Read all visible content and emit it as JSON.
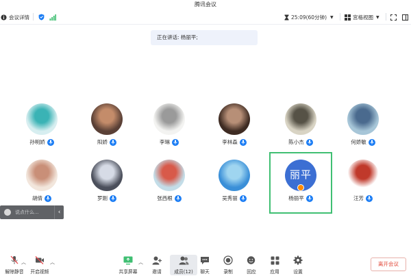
{
  "window": {
    "title": "腾讯会议"
  },
  "topbar": {
    "meeting_info": "会议详情",
    "timer": "25:09(60分钟)",
    "view_mode": "宫格视图"
  },
  "speaking": {
    "text": "正在讲话: 杨丽平;"
  },
  "participants": [
    {
      "name": "孙明娇",
      "avatar_colors": [
        "#d7eef0",
        "#3ab3b5"
      ]
    },
    {
      "name": "阳娇",
      "avatar_colors": [
        "#5a4036",
        "#c48c6a"
      ]
    },
    {
      "name": "李琳",
      "avatar_colors": [
        "#f3f3f1",
        "#9a9a9a"
      ]
    },
    {
      "name": "李林森",
      "avatar_colors": [
        "#3e2b22",
        "#b78f77"
      ]
    },
    {
      "name": "陈小杰",
      "avatar_colors": [
        "#d9d4c4",
        "#565246"
      ]
    },
    {
      "name": "何娇敏",
      "avatar_colors": [
        "#a7c6d8",
        "#4a6a8e"
      ]
    },
    {
      "name": "胡倩",
      "avatar_colors": [
        "#f2e6dc",
        "#c98f78"
      ]
    },
    {
      "name": "罗刚",
      "avatar_colors": [
        "#4b4f5b",
        "#d6dbe6"
      ]
    },
    {
      "name": "张西根",
      "avatar_colors": [
        "#c3dde8",
        "#d85a4a"
      ]
    },
    {
      "name": "吴秀丽",
      "avatar_colors": [
        "#3a8fd8",
        "#9fd5f0"
      ]
    },
    {
      "name": "杨丽平",
      "avatar_text": "丽平",
      "avatar_colors": [
        "#3c6fd3",
        "#3c6fd3"
      ],
      "speaking": true
    },
    {
      "name": "汪芳",
      "avatar_colors": [
        "#ffffff",
        "#c0392b"
      ]
    }
  ],
  "chat": {
    "placeholder": "说点什么..."
  },
  "toolbar": {
    "unmute": "解除静音",
    "start_video": "开启视频",
    "share_screen": "共享屏幕",
    "invite": "邀请",
    "members": "成员(12)",
    "chat": "聊天",
    "record": "录制",
    "playback": "回应",
    "apps": "应用",
    "settings": "设置",
    "leave": "离开会议"
  },
  "colors": {
    "accent": "#1a7cf4",
    "speaking_border": "#3fbf72",
    "leave_text": "#e24a3b",
    "muted_red": "#e5484d"
  }
}
